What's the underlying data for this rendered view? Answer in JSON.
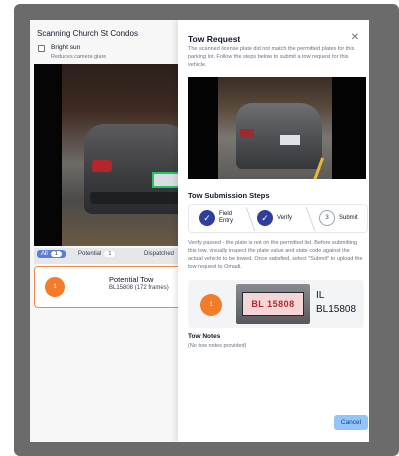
{
  "background": {
    "title": "Scanning Church St Condos",
    "bright_sun_label": "Bright sun",
    "bright_sun_hint": "Reduces camera glare",
    "tabs": [
      {
        "label": "All",
        "count": "1"
      },
      {
        "label": "Potential",
        "count": "1"
      },
      {
        "label": "Dispatched",
        "count": ""
      }
    ],
    "card": {
      "badge": "1",
      "title": "Potential Tow",
      "subtitle": "BL15808 (172 frames)"
    }
  },
  "dialog": {
    "title": "Tow Request",
    "close_icon": "close-icon",
    "description": "The scanned license plate did not match the permitted plates for this parking lot. Follow the steps below to submit a tow request for this vehicle.",
    "steps_title": "Tow Submission Steps",
    "steps": [
      {
        "label_line1": "Field",
        "label_line2": "Entry",
        "state": "done",
        "icon": "check-icon"
      },
      {
        "label_line1": "Verify",
        "label_line2": "",
        "state": "done",
        "icon": "check-icon"
      },
      {
        "number": "3",
        "label_line1": "Submit",
        "label_line2": "",
        "state": "todo"
      }
    ],
    "steps_description": "Verify passed - the plate is not on the permitted list. Before submitting this tow, visually inspect the plate value and state code against the actual vehicle to be towed. Once satisfied, select \"Submit\" to upload the tow request to Omadi.",
    "plate_card": {
      "badge": "1",
      "plate_image_text": "BL 15808",
      "state": "IL",
      "plate": "BL15808"
    },
    "notes_title": "Tow Notes",
    "notes_body": "(No tow notes provided)",
    "cancel_label": "Cancel"
  },
  "colors": {
    "frame": "#6b6b6b",
    "accent": "#2f3d9c",
    "warning": "#f47b2a",
    "button": "#93c5fd"
  }
}
